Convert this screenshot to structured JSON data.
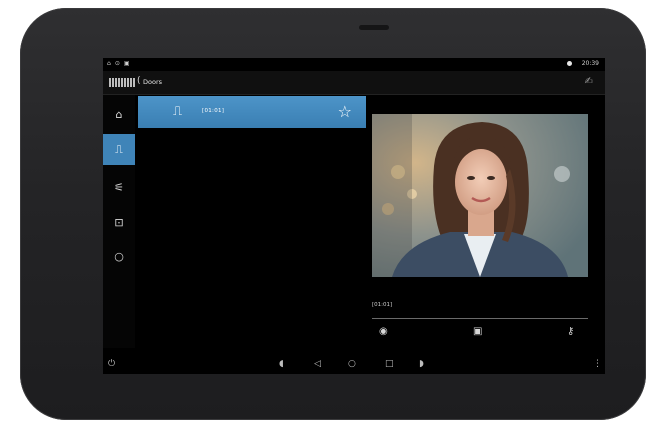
{
  "status_bar": {
    "left_icons": [
      "home-small-icon",
      "wifi-icon",
      "notification-icon"
    ],
    "battery_label": "",
    "time": "20:39"
  },
  "app_bar": {
    "back_symbol": "(",
    "breadcrumb": "Doors",
    "right_icon": "mute-icon"
  },
  "sidebar": {
    "items": [
      {
        "name": "home-icon",
        "glyph": "⌂",
        "active": false
      },
      {
        "name": "door-icon",
        "glyph": "⎍",
        "active": true
      },
      {
        "name": "handset-icon",
        "glyph": "⚟",
        "active": false
      },
      {
        "name": "contact-card-icon",
        "glyph": "⊡",
        "active": false
      },
      {
        "name": "settings-icon",
        "glyph": "○",
        "active": false
      }
    ]
  },
  "door_list": [
    {
      "label": "[01:01]",
      "icon": "door-icon",
      "favorite_icon": "star-outline-icon"
    }
  ],
  "video_panel": {
    "caller_label": "[01:01]",
    "controls": [
      {
        "name": "eye-icon",
        "glyph": "◉"
      },
      {
        "name": "camera-icon",
        "glyph": "▣"
      },
      {
        "name": "key-icon",
        "glyph": "⚷"
      }
    ]
  },
  "nav_bar": {
    "left_icon": "power-icon",
    "icons": [
      "volume-icon",
      "back-icon",
      "home-circle-icon",
      "recents-icon",
      "volume-up-icon"
    ],
    "right_icon": "more-icon"
  },
  "colors": {
    "accent": "#3f84b8",
    "device": "#2a2a2c",
    "screen": "#000000"
  }
}
